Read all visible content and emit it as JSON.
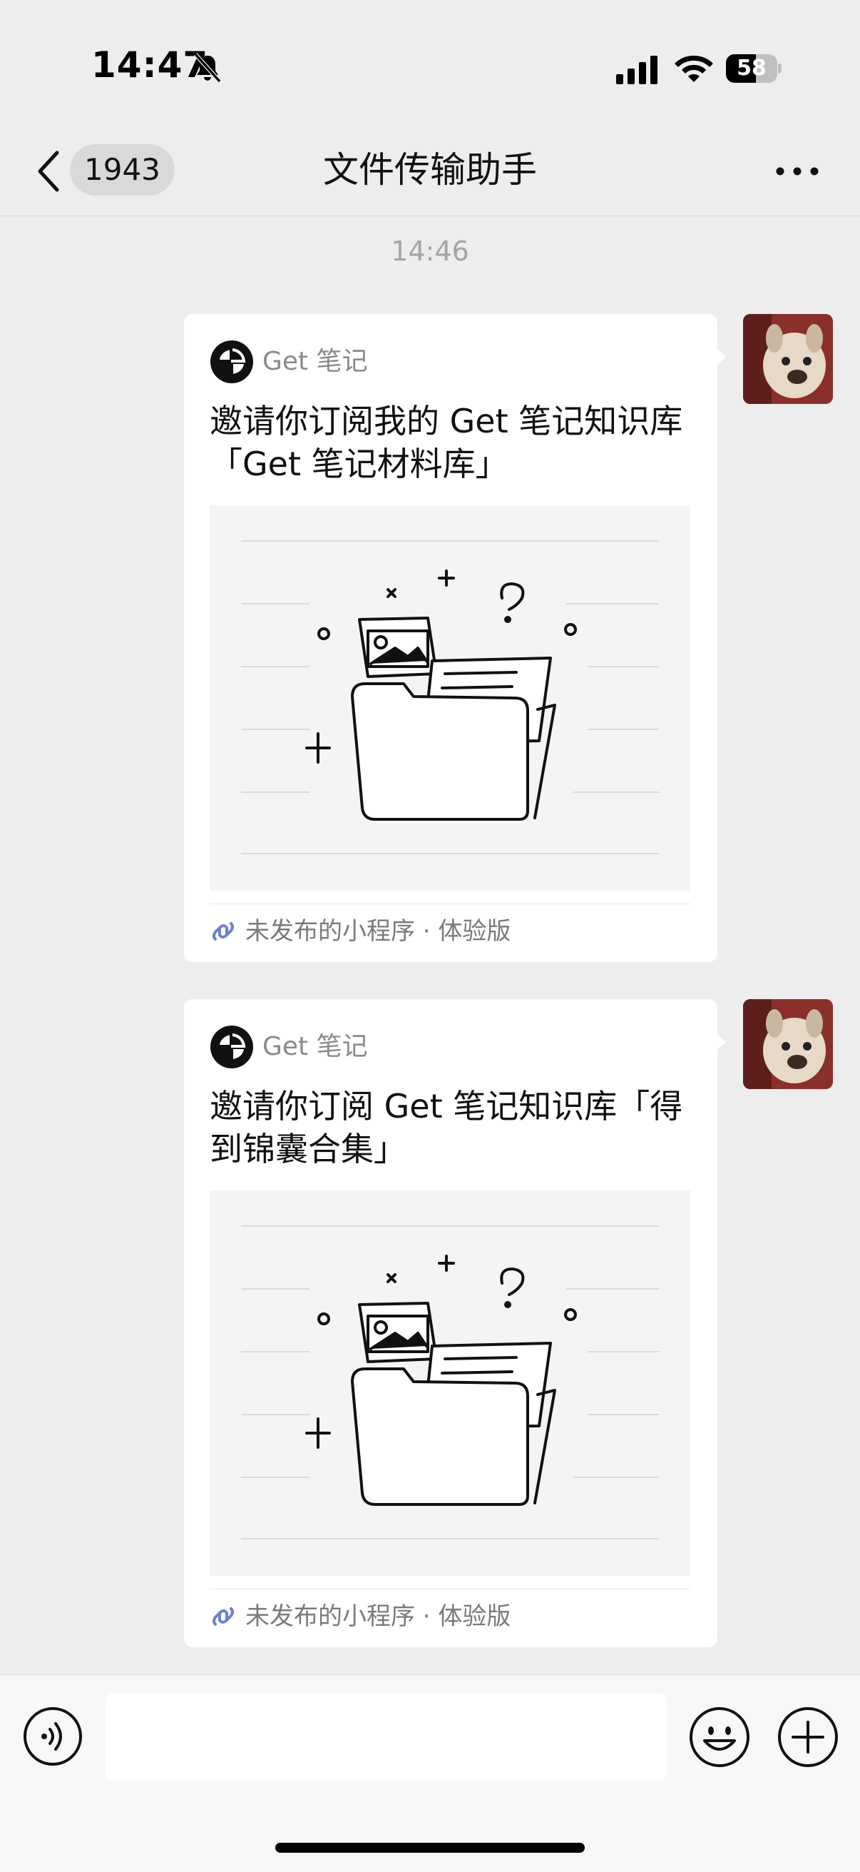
{
  "status_bar": {
    "time": "14:47",
    "battery_level": "58",
    "battery_fraction": 0.58
  },
  "nav": {
    "back_badge": "1943",
    "title": "文件传输助手"
  },
  "chat": {
    "timestamp": "14:46",
    "messages": [
      {
        "app_name": "Get 笔记",
        "title": "邀请你订阅我的 Get 笔记知识库「Get 笔记材料库」",
        "footer": "未发布的小程序 · 体验版"
      },
      {
        "app_name": "Get 笔记",
        "title": "邀请你订阅 Get 笔记知识库「得到锦囊合集」",
        "footer": "未发布的小程序 · 体验版"
      }
    ]
  },
  "input_bar": {
    "placeholder": ""
  },
  "icons": {
    "back": "chevron-left-icon",
    "more": "more-dots-icon",
    "voice": "voice-icon",
    "emoji": "emoji-icon",
    "plus": "plus-icon",
    "mini_program": "mini-program-link-icon",
    "app_logo": "get-notes-logo-icon"
  }
}
